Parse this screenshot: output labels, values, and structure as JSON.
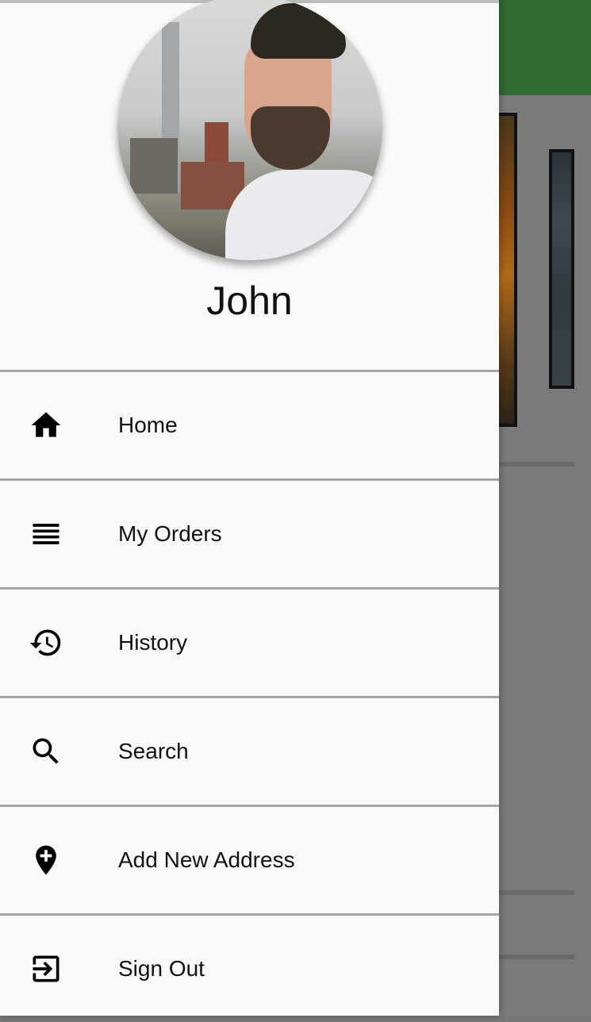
{
  "user": {
    "name": "John"
  },
  "menu": {
    "items": [
      {
        "label": "Home",
        "icon": "home-icon"
      },
      {
        "label": "My Orders",
        "icon": "list-icon"
      },
      {
        "label": "History",
        "icon": "history-icon"
      },
      {
        "label": "Search",
        "icon": "search-icon"
      },
      {
        "label": "Add New Address",
        "icon": "add-location-icon"
      },
      {
        "label": "Sign Out",
        "icon": "sign-out-icon"
      }
    ]
  },
  "colors": {
    "appbar": "#2f6a30",
    "drawer": "#fafafa",
    "divider": "#a5a5a5",
    "scrim": "#7a7a7a"
  }
}
